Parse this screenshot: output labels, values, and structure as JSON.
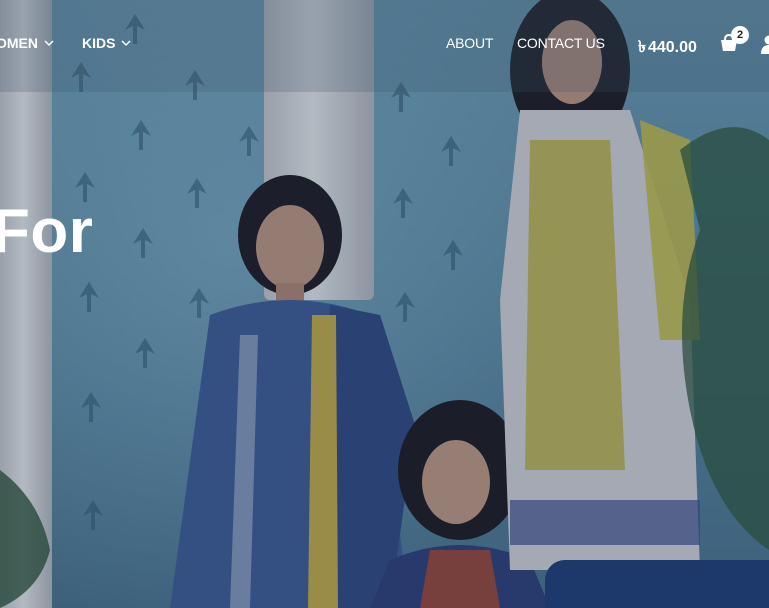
{
  "nav": {
    "items": [
      {
        "label": "OMEN"
      },
      {
        "label": "KIDS"
      },
      {
        "label": "ABOUT"
      },
      {
        "label": "CONTACT US"
      }
    ]
  },
  "cart": {
    "currency_symbol": "৳",
    "total": "440.00",
    "count": "2"
  },
  "hero": {
    "headline": "For"
  },
  "icons": [
    "chevron-down-icon",
    "cart-icon",
    "user-icon",
    "taka-icon"
  ],
  "colors": {
    "wall": "#5f8fa8",
    "header_text": "#ffffff",
    "overlay": "#1e2d46"
  }
}
